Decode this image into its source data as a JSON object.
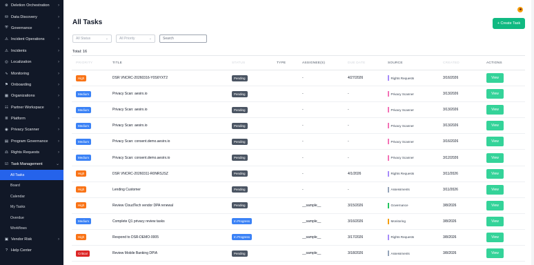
{
  "sidebar": {
    "items": [
      {
        "label": "Deletion Orchestration",
        "icon": "trash-icon",
        "glyph": "⊗",
        "chevron": "›"
      },
      {
        "label": "Data Discovery",
        "icon": "database-icon",
        "glyph": "⛁",
        "chevron": "›"
      },
      {
        "label": "Governance",
        "icon": "shield-icon",
        "glyph": "⛨",
        "chevron": "›"
      },
      {
        "label": "Incident Operations",
        "icon": "alert-icon",
        "glyph": "⚠",
        "chevron": "›"
      },
      {
        "label": "Incidents",
        "icon": "warning-icon",
        "glyph": "⚠",
        "chevron": "›"
      },
      {
        "label": "Localization",
        "icon": "globe-icon",
        "glyph": "◎",
        "chevron": "›"
      },
      {
        "label": "Monitoring",
        "icon": "pulse-icon",
        "glyph": "∿",
        "chevron": "›"
      },
      {
        "label": "Onboarding",
        "icon": "flag-icon",
        "glyph": "⚑",
        "chevron": "›"
      },
      {
        "label": "Organizations",
        "icon": "building-icon",
        "glyph": "▦",
        "chevron": "›"
      },
      {
        "label": "Partner Workspace",
        "icon": "users-icon",
        "glyph": "☷",
        "chevron": "›"
      },
      {
        "label": "Platform",
        "icon": "layers-icon",
        "glyph": "≣",
        "chevron": "›"
      },
      {
        "label": "Privacy Scanner",
        "icon": "scan-icon",
        "glyph": "◉",
        "chevron": "›"
      },
      {
        "label": "Program Governance",
        "icon": "clipboard-icon",
        "glyph": "▤",
        "chevron": "›"
      },
      {
        "label": "Rights Requests",
        "icon": "scale-icon",
        "glyph": "⚖",
        "chevron": "›"
      },
      {
        "label": "Task Management",
        "icon": "checklist-icon",
        "glyph": "☑",
        "chevron": "⌄"
      }
    ],
    "sub_items": [
      {
        "label": "All Tasks",
        "active": true
      },
      {
        "label": "Board",
        "active": false
      },
      {
        "label": "Calendar",
        "active": false
      },
      {
        "label": "My Tasks",
        "active": false
      },
      {
        "label": "Overdue",
        "active": false
      },
      {
        "label": "Workflows",
        "active": false
      }
    ],
    "bottom_items": [
      {
        "label": "Vendor Risk",
        "icon": "briefcase-icon",
        "glyph": "▣",
        "chevron": "›"
      },
      {
        "label": "Help Center",
        "icon": "help-icon",
        "glyph": "?",
        "chevron": ""
      }
    ]
  },
  "header": {
    "title": "All Tasks",
    "create_label": "+ Create Task"
  },
  "filters": {
    "status_placeholder": "All Status",
    "priority_placeholder": "All Priority",
    "search_placeholder": "Search"
  },
  "total_label": "Total: 16",
  "table": {
    "columns": {
      "priority": "Priority",
      "title": "Title",
      "status": "Status",
      "type": "Type",
      "assignees": "Assignee(s)",
      "due": "Due Date",
      "source": "Source",
      "created": "Created",
      "actions": "Actions"
    },
    "view_label": "View",
    "rows": [
      {
        "priority": "High",
        "title": "DSR VNCRC-20260316-Y0S6YXT2",
        "status": "Pending",
        "assignee": "-",
        "due": "4/27/2026",
        "source": "Rights Requests",
        "created": "3/16/2026"
      },
      {
        "priority": "Medium",
        "title": "Privacy Scan: aesirx.io",
        "status": "Pending",
        "assignee": "-",
        "due": "-",
        "source": "Privacy Scanner",
        "created": "3/13/2026"
      },
      {
        "priority": "Medium",
        "title": "Privacy Scan: aesirx.io",
        "status": "Pending",
        "assignee": "-",
        "due": "-",
        "source": "Privacy Scanner",
        "created": "3/13/2026"
      },
      {
        "priority": "Medium",
        "title": "Privacy Scan: aesirx.io",
        "status": "Pending",
        "assignee": "-",
        "due": "-",
        "source": "Privacy Scanner",
        "created": "3/13/2026"
      },
      {
        "priority": "Medium",
        "title": "Privacy Scan: consent.demo.aesirx.io",
        "status": "Pending",
        "assignee": "-",
        "due": "-",
        "source": "Privacy Scanner",
        "created": "3/16/2026"
      },
      {
        "priority": "Medium",
        "title": "Privacy Scan: consent.demo.aesirx.io",
        "status": "Pending",
        "assignee": "-",
        "due": "-",
        "source": "Privacy Scanner",
        "created": "3/12/2026"
      },
      {
        "priority": "High",
        "title": "DSR VNCRC-20260311-R0NRSJSZ",
        "status": "Pending",
        "assignee": "-",
        "due": "4/1/2026",
        "source": "Rights Requests",
        "created": "3/11/2026"
      },
      {
        "priority": "High",
        "title": "Lending Customer",
        "status": "Pending",
        "assignee": "-",
        "due": "-",
        "source": "Assessments",
        "created": "3/11/2026"
      },
      {
        "priority": "High",
        "title": "Review CloudTech vendor DPA renewal",
        "status": "Pending",
        "assignee": "__sample__",
        "due": "3/15/2026",
        "source": "Governance",
        "created": "3/8/2026"
      },
      {
        "priority": "Medium",
        "title": "Complete Q1 privacy review tasks",
        "status": "In Progress",
        "assignee": "__sample__",
        "due": "3/16/2026",
        "source": "Monitoring",
        "created": "3/8/2026"
      },
      {
        "priority": "High",
        "title": "Respond to DSR-DEMO-0005",
        "status": "In Progress",
        "assignee": "__sample__",
        "due": "3/17/2026",
        "source": "Rights Requests",
        "created": "3/8/2026"
      },
      {
        "priority": "Critical",
        "title": "Review Mobile Banking DPIA",
        "status": "Pending",
        "assignee": "__sample__",
        "due": "3/18/2026",
        "source": "Assessments",
        "created": "3/8/2026"
      }
    ]
  },
  "colors": {
    "priority": {
      "High": "#f97316",
      "Medium": "#3b82f6",
      "Critical": "#dc2626"
    },
    "status": {
      "Pending": "#4b5563",
      "In Progress": "#3b82f6"
    },
    "source": {
      "Rights Requests": "#a78bfa",
      "Privacy Scanner": "#f472b6",
      "Assessments": "#94a3b8",
      "Governance": "#22c55e",
      "Monitoring": "#f59e0b"
    },
    "accent": "#10b981",
    "sidebar_bg": "#111827",
    "active_nav": "#2563eb"
  }
}
